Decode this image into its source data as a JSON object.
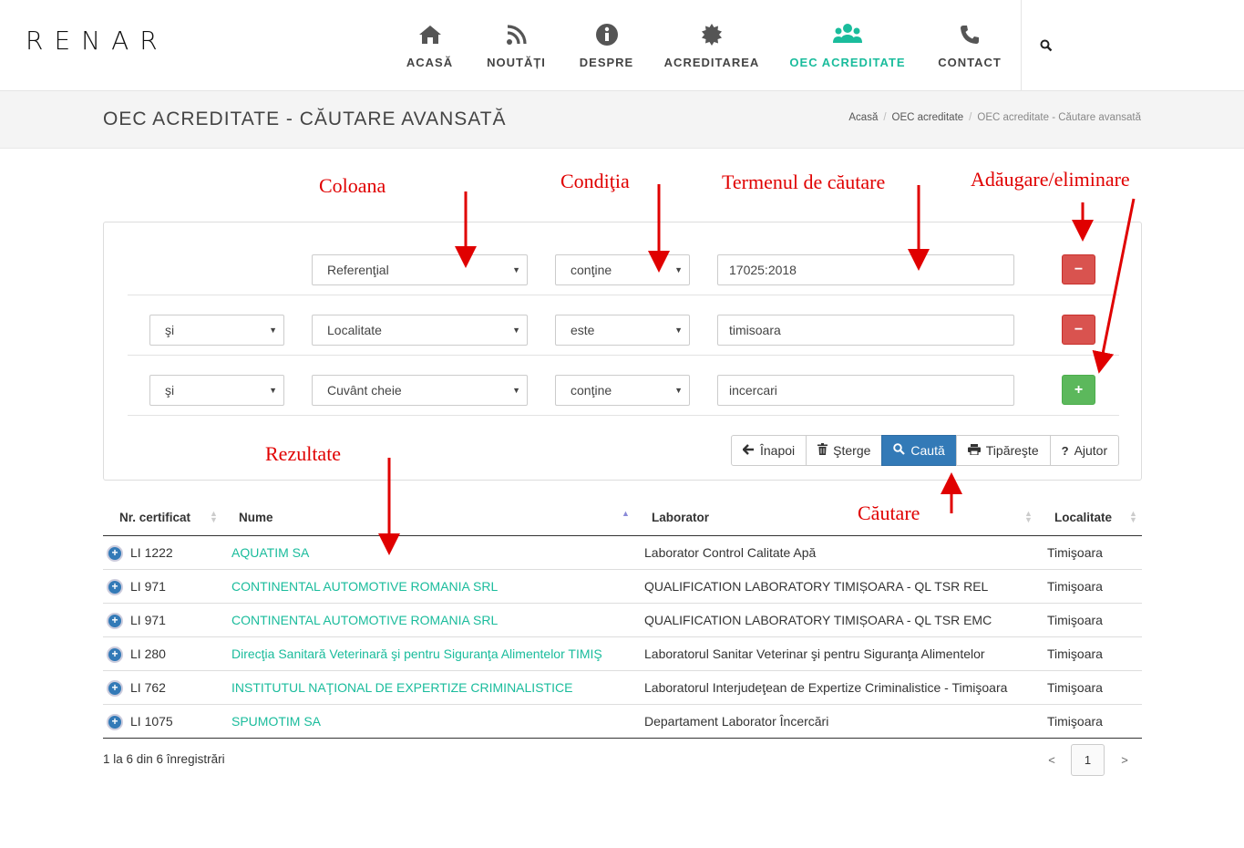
{
  "brand": "RENAR",
  "nav": {
    "items": [
      {
        "label": "ACASĂ",
        "icon": "home-icon"
      },
      {
        "label": "NOUTĂȚI",
        "icon": "rss-icon"
      },
      {
        "label": "DESPRE",
        "icon": "info-icon"
      },
      {
        "label": "ACREDITAREA",
        "icon": "certificate-icon"
      },
      {
        "label": "OEC ACREDITATE",
        "icon": "users-icon",
        "active": true
      },
      {
        "label": "CONTACT",
        "icon": "phone-icon"
      }
    ],
    "search_icon": "search-icon",
    "active_color": "#1abc9c"
  },
  "page": {
    "title": "OEC ACREDITATE - CĂUTARE AVANSATĂ",
    "breadcrumb": [
      "Acasă",
      "OEC acreditate",
      "OEC acreditate - Căutare avansată"
    ]
  },
  "annotations": {
    "column": "Coloana",
    "condition": "Condiţia",
    "term": "Termenul de căutare",
    "add_remove": "Adăugare/eliminare",
    "results": "Rezultate",
    "search": "Căutare",
    "color": "#e00000"
  },
  "filters": [
    {
      "logic": "",
      "column": "Referenţial",
      "condition": "conţine",
      "value": "17025:2018",
      "action": "−",
      "action_type": "remove"
    },
    {
      "logic": "şi",
      "column": "Localitate",
      "condition": "este",
      "value": "timisoara",
      "action": "−",
      "action_type": "remove"
    },
    {
      "logic": "şi",
      "column": "Cuvânt cheie",
      "condition": "conţine",
      "value": "incercari",
      "action": "+",
      "action_type": "add"
    }
  ],
  "buttons": {
    "back": "Înapoi",
    "clear": "Şterge",
    "search": "Caută",
    "print": "Tipăreşte",
    "help": "Ajutor"
  },
  "table": {
    "headers": [
      "Nr. certificat",
      "Nume",
      "Laborator",
      "Localitate"
    ],
    "rows": [
      {
        "cert": "LI 1222",
        "name": "AQUATIM SA",
        "lab": "Laborator Control Calitate Apă",
        "city": "Timişoara"
      },
      {
        "cert": "LI 971",
        "name": "CONTINENTAL AUTOMOTIVE ROMANIA SRL",
        "lab": "QUALIFICATION LABORATORY TIMIȘOARA - QL TSR REL",
        "city": "Timişoara"
      },
      {
        "cert": "LI 971",
        "name": "CONTINENTAL AUTOMOTIVE ROMANIA SRL",
        "lab": "QUALIFICATION LABORATORY TIMIȘOARA - QL TSR EMC",
        "city": "Timişoara"
      },
      {
        "cert": "LI 280",
        "name": "Direcţia Sanitară Veterinară şi pentru Siguranţa Alimentelor TIMIŞ",
        "lab": "Laboratorul Sanitar Veterinar şi pentru Siguranţa Alimentelor",
        "city": "Timişoara"
      },
      {
        "cert": "LI 762",
        "name": "INSTITUTUL NAŢIONAL DE EXPERTIZE CRIMINALISTICE",
        "lab": "Laboratorul Interjudeţean de Expertize Criminalistice - Timişoara",
        "city": "Timişoara"
      },
      {
        "cert": "LI 1075",
        "name": "SPUMOTIM SA",
        "lab": "Departament Laborator Încercări",
        "city": "Timişoara"
      }
    ],
    "info": "1 la 6 din 6 înregistrări"
  },
  "pagination": {
    "prev": "<",
    "current": "1",
    "next": ">"
  }
}
